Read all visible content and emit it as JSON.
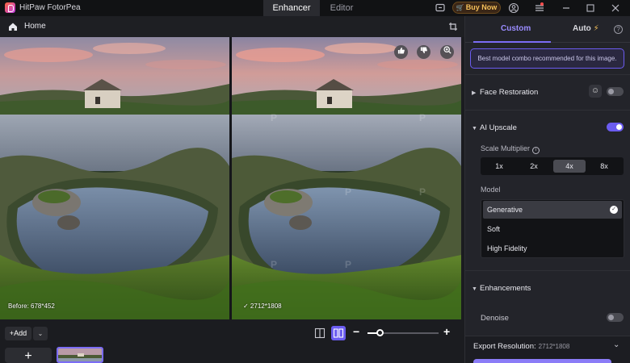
{
  "app": {
    "title": "HitPaw FotorPea"
  },
  "mode_tabs": [
    {
      "label": "Enhancer",
      "active": true
    },
    {
      "label": "Editor",
      "active": false
    }
  ],
  "titlebar": {
    "buy_label": "Buy Now",
    "accent": "#f5c05a"
  },
  "homebar": {
    "home_label": "Home"
  },
  "preview": {
    "before_label": "Before: 678*452",
    "after_label": "✓  2712*1808"
  },
  "bottombar": {
    "add_label": "Add",
    "zoom_level_fraction": 0.17
  },
  "panel": {
    "tabs": [
      {
        "label": "Custom",
        "active": true
      },
      {
        "label": "Auto",
        "active": false
      }
    ],
    "tip": "Best model combo recommended for this image.",
    "face_restoration": {
      "label": "Face Restoration",
      "enabled": false
    },
    "ai_upscale": {
      "label": "AI Upscale",
      "enabled": true,
      "scale_label": "Scale Multiplier",
      "scales": [
        "1x",
        "2x",
        "4x",
        "8x"
      ],
      "selected_scale": "4x",
      "model_label": "Model",
      "models": [
        "Generative",
        "Soft",
        "High Fidelity"
      ],
      "selected_model": "Generative"
    },
    "enhancements": {
      "label": "Enhancements",
      "denoise_label": "Denoise",
      "denoise_enabled": false
    },
    "export": {
      "label": "Export Resolution:",
      "value": "2712*1808"
    }
  },
  "colors": {
    "accent": "#6b5cf0",
    "accent_light": "#9a8cff"
  }
}
